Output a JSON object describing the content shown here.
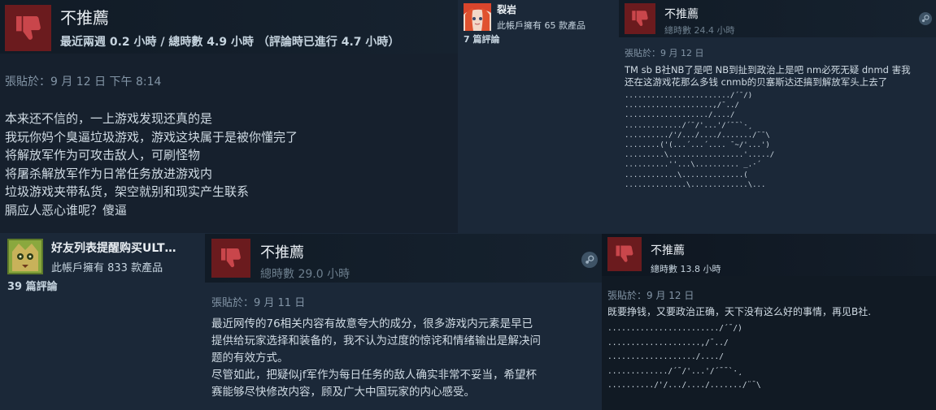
{
  "colors": {
    "page_bg": "#1b2838",
    "thumb_bg": "#6b1b1e",
    "thumb_icon": "#c9464b",
    "text": "#c6d4df",
    "dim_text": "#8395a6"
  },
  "review1": {
    "verdict": "不推薦",
    "hours": "最近兩週 0.2 小時 / 總時數 4.9 小時 （評論時已進行 4.7 小時）",
    "posted": "張貼於：9 月 12 日 下午 8:14",
    "body": "本来还不信的，一上游戏发现还真的是\n我玩你妈个臭逼垃圾游戏，游戏这块属于是被你懂完了\n将解放军作为可攻击敌人，可刷怪物\n将屠杀解放军作为日常任务放进游戏内\n垃圾游戏夹带私货，架空就别和现实产生联系\n膈应人恶心谁呢？傻逼",
    "icon": "thumbs-down-icon"
  },
  "reviewer2": {
    "name": "裂岩",
    "products": "此帳戶擁有 65 款產品",
    "reviews": "7 篇評論"
  },
  "review3": {
    "verdict": "不推薦",
    "hours": "總時數 24.4 小時",
    "posted": "張貼於：9 月 12 日",
    "body": "TM sb B社NB了是吧 NB到扯到政治上是吧 nm必死无疑 dnmd 害我\n还在这游戏花那么多钱 cnmb的贝塞斯达还搞到解放军头上去了",
    "ascii": "......................../´¯/)\n....................,/¯../\n.................../..../\n............./´¯/'...'/´¯¯`·¸\n........../'/.../..../......./¨¯\\\n........('(...´...´.... ¯~/'...')\n.........\\.................'...../\n..........''...\\.......... _.·´\n............\\..............(\n..............\\.............\\...",
    "icon": "thumbs-down-icon"
  },
  "reviewer4": {
    "name": "好友列表提醒购买ULT…",
    "products": "此帳戶擁有 833 款產品",
    "reviews": "39 篇評論"
  },
  "review5": {
    "verdict": "不推薦",
    "hours": "總時數 29.0 小時",
    "posted": "張貼於：9 月 11 日",
    "body": "最近网传的76相关内容有故意夸大的成分，很多游戏内元素是早已\n提供给玩家选择和装备的，我不认为过度的惊诧和情绪输出是解决问\n题的有效方式。\n尽管如此，把疑似jf军作为每日任务的敌人确实非常不妥当，希望杯\n赛能够尽快修改内容，顾及广大中国玩家的内心感受。",
    "icon": "thumbs-down-icon"
  },
  "review6": {
    "verdict": "不推薦",
    "hours": "總時數 13.8 小時",
    "posted": "張貼於：9 月 12 日",
    "body": "既要挣钱，又要政治正确，天下没有这么好的事情，再见B社.",
    "ascii": "......................../´¯/)\n....................,/¯../\n.................../..../\n............./´¯/'...'/´¯¯`·¸\n........../'/.../..../......./¨¯\\",
    "icon": "thumbs-down-icon"
  }
}
